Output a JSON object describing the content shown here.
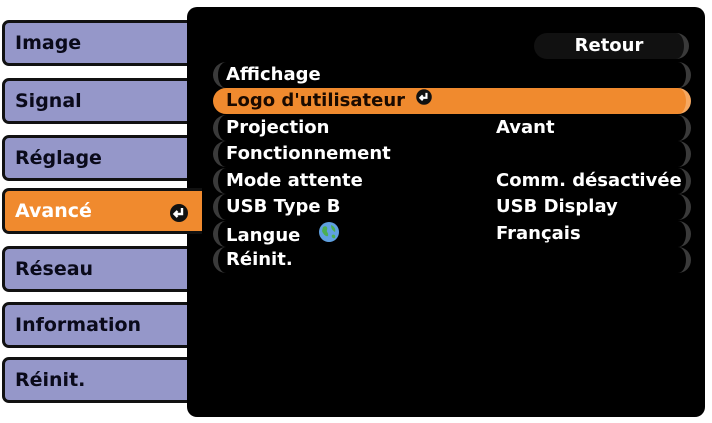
{
  "sidebar": {
    "items": [
      {
        "label": "Image"
      },
      {
        "label": "Signal"
      },
      {
        "label": "Réglage"
      },
      {
        "label": "Avancé"
      },
      {
        "label": "Réseau"
      },
      {
        "label": "Information"
      },
      {
        "label": "Réinit."
      }
    ],
    "active_index": 3
  },
  "panel": {
    "back_label": "Retour",
    "rows": [
      {
        "label": "Affichage",
        "value": ""
      },
      {
        "label": "Logo d'utilisateur",
        "value": ""
      },
      {
        "label": "Projection",
        "value": "Avant"
      },
      {
        "label": "Fonctionnement",
        "value": ""
      },
      {
        "label": "Mode attente",
        "value": "Comm. désactivée"
      },
      {
        "label": "USB Type B",
        "value": "USB Display"
      },
      {
        "label": "Langue",
        "value": "Français"
      },
      {
        "label": "Réinit.",
        "value": ""
      }
    ],
    "highlighted_index": 1
  },
  "colors": {
    "accent": "#f08a2e",
    "tab_bg": "#9597c9",
    "panel_bg": "#000000"
  },
  "icons": {
    "enter": "enter-icon",
    "language": "globe-icon"
  }
}
